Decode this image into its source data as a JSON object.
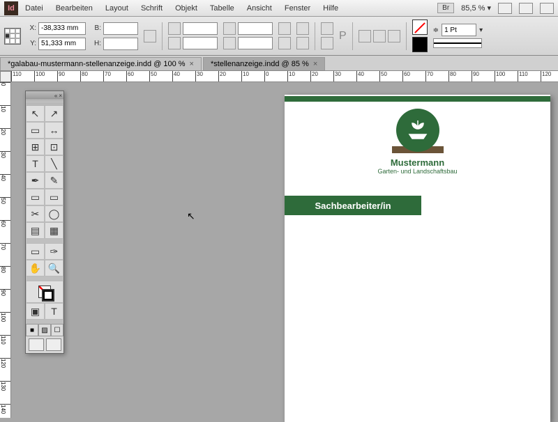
{
  "app": {
    "id_label": "Id"
  },
  "menu": {
    "items": [
      "Datei",
      "Bearbeiten",
      "Layout",
      "Schrift",
      "Objekt",
      "Tabelle",
      "Ansicht",
      "Fenster",
      "Hilfe"
    ],
    "br": "Br",
    "zoom": "85,5 %"
  },
  "control": {
    "x_label": "X:",
    "x_value": "-38,333 mm",
    "y_label": "Y:",
    "y_value": "51,333 mm",
    "w_label": "B:",
    "w_value": "",
    "h_label": "H:",
    "h_value": "",
    "stroke_weight": "1 Pt"
  },
  "tabs": [
    {
      "label": "*galabau-mustermann-stellenanzeige.indd @ 100 %",
      "active": false
    },
    {
      "label": "*stellenanzeige.indd @ 85 %",
      "active": true
    }
  ],
  "ruler_h": [
    -110,
    -100,
    -90,
    -80,
    -70,
    -60,
    -50,
    -40,
    -30,
    -20,
    -10,
    0,
    10,
    20,
    30,
    40,
    50,
    60,
    70,
    80,
    90,
    100,
    110,
    120
  ],
  "ruler_v": [
    0,
    10,
    20,
    30,
    40,
    50,
    60,
    70,
    80,
    90,
    100,
    110,
    120,
    130,
    140
  ],
  "document": {
    "company": "Mustermann",
    "subtitle": "Garten- und Landschaftsbau",
    "job_title": "Sachbearbeiter/in"
  },
  "tools": {
    "collapse": "«",
    "close": "×",
    "selection": "↖",
    "direct": "↗",
    "page": "▭",
    "gap": "↔",
    "content": "⊞",
    "place": "⊡",
    "type": "T",
    "line": "╲",
    "pen": "✒",
    "pencil": "✎",
    "rect": "▭",
    "ellipse": "▭",
    "scissors": "✂",
    "rotate": "◯",
    "gradient": "▤",
    "feather": "▦",
    "note": "▭",
    "eyedrop": "✑",
    "hand": "✋",
    "zoom": "🔍",
    "t_mode": "T"
  }
}
